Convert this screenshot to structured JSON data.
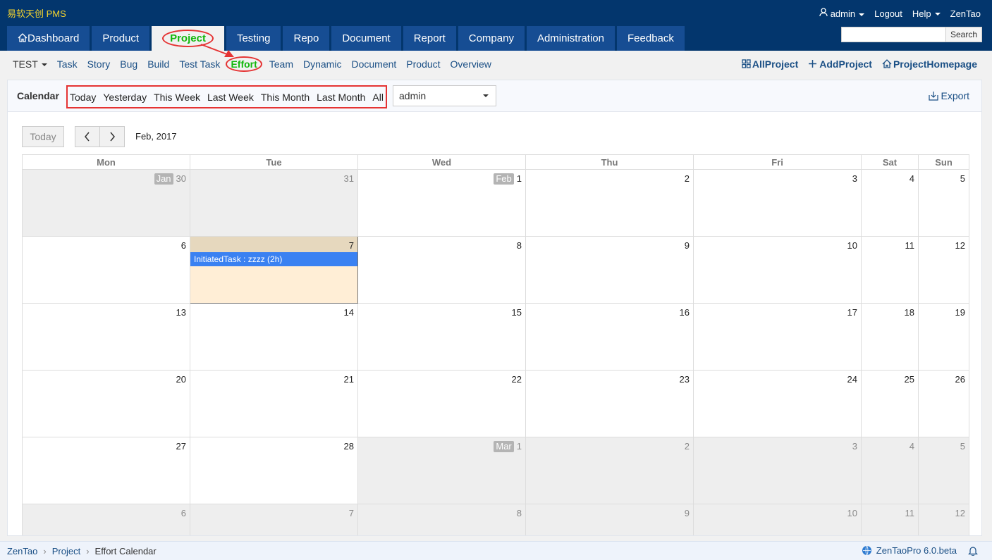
{
  "header": {
    "company": "易软天创 PMS",
    "user_label": "admin",
    "logout": "Logout",
    "help": "Help",
    "brand": "ZenTao",
    "search_label": "Search",
    "nav": [
      "Dashboard",
      "Product",
      "Project",
      "Testing",
      "Repo",
      "Document",
      "Report",
      "Company",
      "Administration",
      "Feedback"
    ]
  },
  "subnav": {
    "project_name": "TEST",
    "items": [
      "Task",
      "Story",
      "Bug",
      "Build",
      "Test Task",
      "Effort",
      "Team",
      "Dynamic",
      "Document",
      "Product",
      "Overview"
    ],
    "right": [
      "AllProject",
      "AddProject",
      "ProjectHomepage"
    ]
  },
  "filter": {
    "label": "Calendar",
    "options": [
      "Today",
      "Yesterday",
      "This Week",
      "Last Week",
      "This Month",
      "Last Month",
      "All"
    ],
    "user": "admin",
    "export": "Export"
  },
  "calendar": {
    "today_btn": "Today",
    "month": "Feb, 2017",
    "weekdays": [
      "Mon",
      "Tue",
      "Wed",
      "Thu",
      "Fri",
      "Sat",
      "Sun"
    ],
    "weeks": [
      [
        {
          "d": "30",
          "badge": "Jan",
          "other": true
        },
        {
          "d": "31",
          "other": true
        },
        {
          "d": "1",
          "badge": "Feb"
        },
        {
          "d": "2"
        },
        {
          "d": "3"
        },
        {
          "d": "4"
        },
        {
          "d": "5"
        }
      ],
      [
        {
          "d": "6"
        },
        {
          "d": "7",
          "today": true,
          "event": "InitiatedTask : zzzz (2h)"
        },
        {
          "d": "8"
        },
        {
          "d": "9"
        },
        {
          "d": "10"
        },
        {
          "d": "11"
        },
        {
          "d": "12"
        }
      ],
      [
        {
          "d": "13"
        },
        {
          "d": "14"
        },
        {
          "d": "15"
        },
        {
          "d": "16"
        },
        {
          "d": "17"
        },
        {
          "d": "18"
        },
        {
          "d": "19"
        }
      ],
      [
        {
          "d": "20"
        },
        {
          "d": "21"
        },
        {
          "d": "22"
        },
        {
          "d": "23"
        },
        {
          "d": "24"
        },
        {
          "d": "25"
        },
        {
          "d": "26"
        }
      ],
      [
        {
          "d": "27"
        },
        {
          "d": "28"
        },
        {
          "d": "1",
          "badge": "Mar",
          "other": true
        },
        {
          "d": "2",
          "other": true
        },
        {
          "d": "3",
          "other": true
        },
        {
          "d": "4",
          "other": true
        },
        {
          "d": "5",
          "other": true
        }
      ],
      [
        {
          "d": "6",
          "other": true
        },
        {
          "d": "7",
          "other": true
        },
        {
          "d": "8",
          "other": true
        },
        {
          "d": "9",
          "other": true
        },
        {
          "d": "10",
          "other": true
        },
        {
          "d": "11",
          "other": true
        },
        {
          "d": "12",
          "other": true
        }
      ]
    ]
  },
  "footer": {
    "breadcrumb": [
      "ZenTao",
      "Project",
      "Effort Calendar"
    ],
    "version": "ZenTaoPro 6.0.beta"
  },
  "colors": {
    "header_bg": "#03366d",
    "nav_tab": "#164d93",
    "active_green": "#12b70b",
    "annotation_red": "#e53333",
    "event_blue": "#3a81f2",
    "today_cell": "#ffeed6"
  }
}
